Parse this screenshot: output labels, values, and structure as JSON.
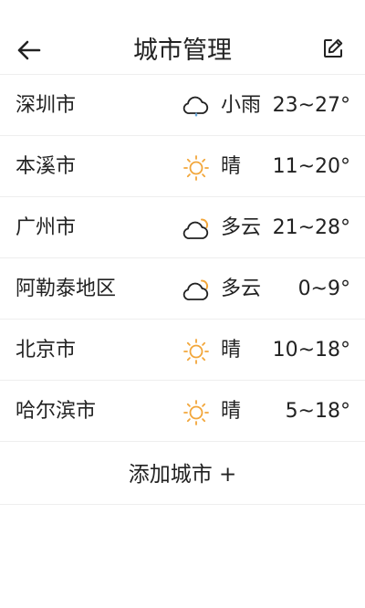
{
  "header": {
    "title": "城市管理",
    "back_icon": "arrow-left-icon",
    "edit_icon": "edit-pencil-icon"
  },
  "cities": [
    {
      "name": "深圳市",
      "icon": "light-rain-icon",
      "condition": "小雨",
      "temp": "23~27°"
    },
    {
      "name": "本溪市",
      "icon": "sunny-icon",
      "condition": "晴",
      "temp": "11~20°"
    },
    {
      "name": "广州市",
      "icon": "partly-cloudy-icon",
      "condition": "多云",
      "temp": "21~28°"
    },
    {
      "name": "阿勒泰地区",
      "icon": "partly-cloudy-icon",
      "condition": "多云",
      "temp": "0~9°"
    },
    {
      "name": "北京市",
      "icon": "sunny-icon",
      "condition": "晴",
      "temp": "10~18°"
    },
    {
      "name": "哈尔滨市",
      "icon": "sunny-icon",
      "condition": "晴",
      "temp": "5~18°"
    }
  ],
  "add_city": {
    "label": "添加城市 +"
  },
  "colors": {
    "sun": "#f2a63a",
    "rain_drop": "#6aa7d8",
    "icon_stroke": "#222222",
    "divider": "#eeeeee"
  }
}
